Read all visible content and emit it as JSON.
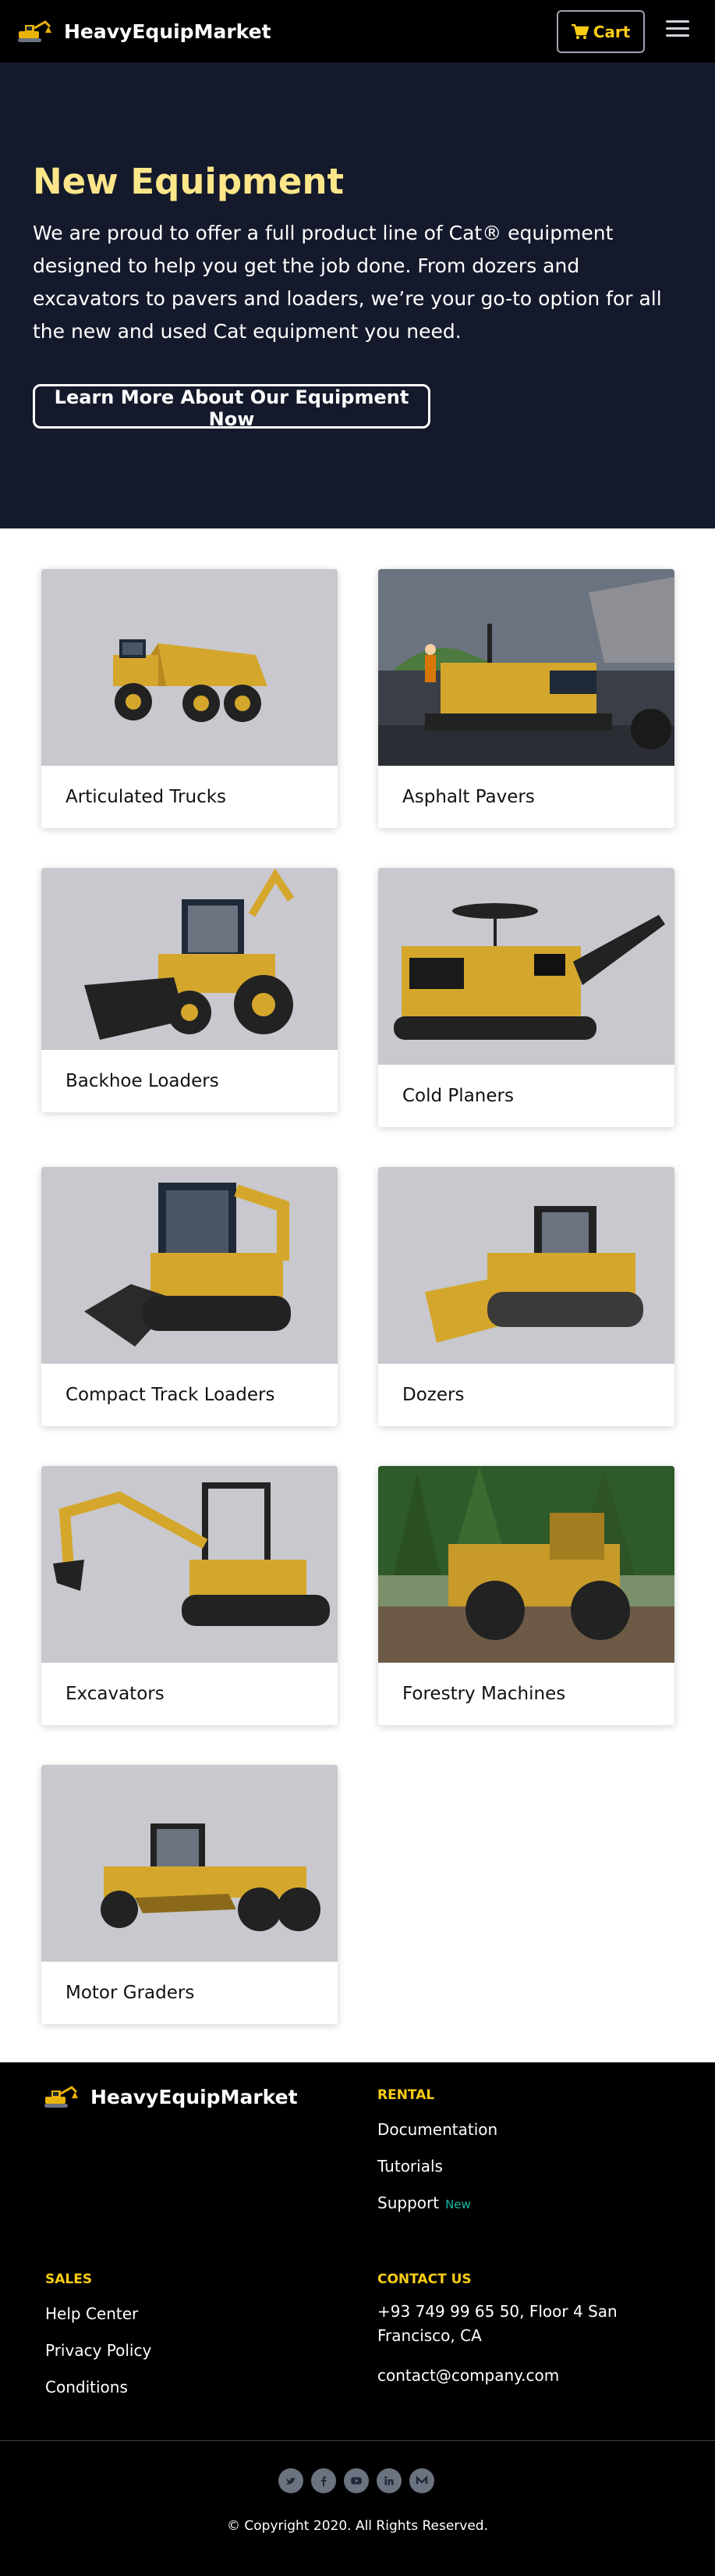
{
  "header": {
    "brand": "HeavyEquipMarket",
    "cart_label": "Cart"
  },
  "hero": {
    "title": "New Equipment",
    "text": "We are proud to offer a full product line of Cat® equipment designed to help you get the job done. From dozers and excavators to pavers and loaders, we’re your go-to option for all the new and used Cat equipment you need.",
    "button": "Learn More About Our Equipment Now"
  },
  "categories": [
    {
      "label": "Articulated Trucks",
      "icon": "articulated-truck"
    },
    {
      "label": "Asphalt Pavers",
      "icon": "asphalt-paver"
    },
    {
      "label": "Backhoe Loaders",
      "icon": "backhoe-loader"
    },
    {
      "label": "Cold Planers",
      "icon": "cold-planer"
    },
    {
      "label": "Compact Track Loaders",
      "icon": "compact-track-loader"
    },
    {
      "label": "Dozers",
      "icon": "dozer"
    },
    {
      "label": "Excavators",
      "icon": "excavator"
    },
    {
      "label": "Forestry Machines",
      "icon": "forestry-machine"
    },
    {
      "label": "Motor Graders",
      "icon": "motor-grader"
    }
  ],
  "footer": {
    "brand": "HeavyEquipMarket",
    "rental": {
      "heading": "RENTAL",
      "links": [
        "Documentation",
        "Tutorials",
        "Support"
      ],
      "badge": "New"
    },
    "sales": {
      "heading": "SALES",
      "links": [
        "Help Center",
        "Privacy Policy",
        "Conditions"
      ]
    },
    "contact": {
      "heading": "CONTACT US",
      "address": "+93 749 99 65 50, Floor 4 San Francisco, CA",
      "email": "contact@company.com"
    },
    "socials": [
      "twitter-icon",
      "facebook-icon",
      "youtube-icon",
      "linkedin-icon",
      "medium-icon"
    ],
    "copyright": "© Copyright 2020. All Rights Reserved."
  },
  "colors": {
    "accent": "#facc15",
    "hero_bg": "#141a2b",
    "hero_title": "#fde68a",
    "badge": "#14b8a6"
  }
}
